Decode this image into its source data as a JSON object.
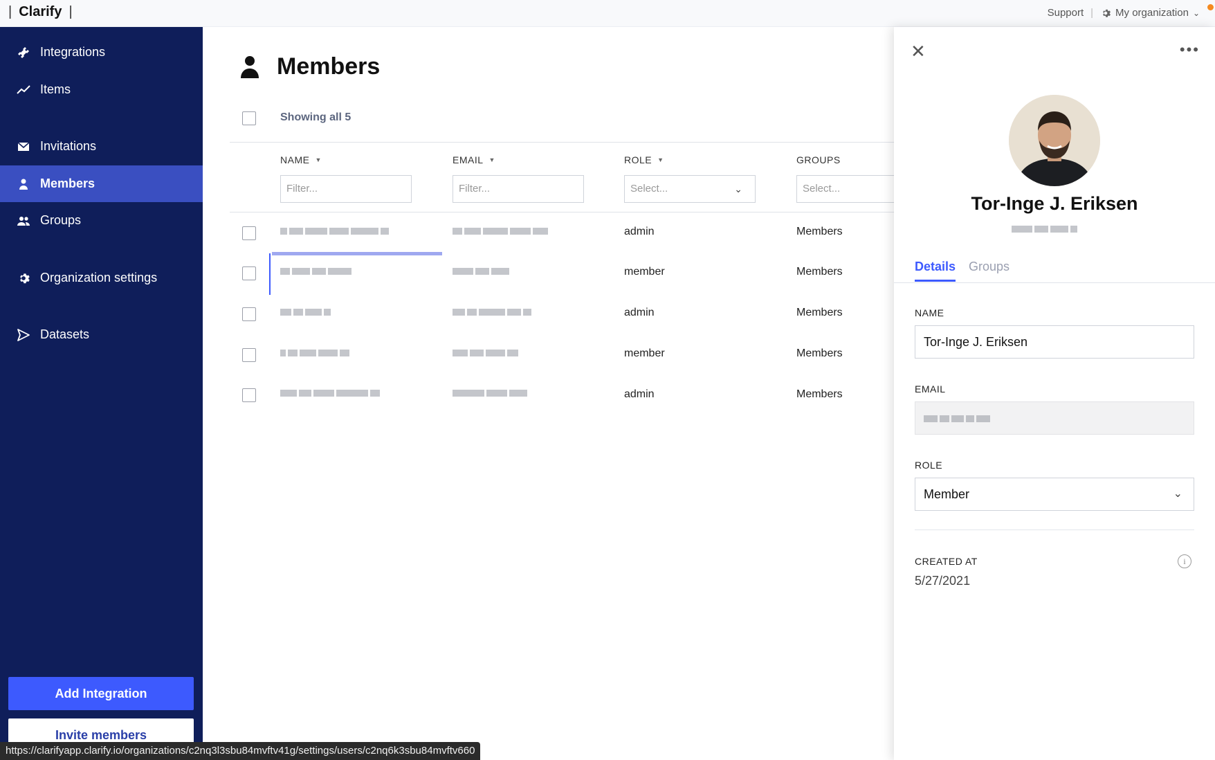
{
  "app": {
    "brand": "Clarify"
  },
  "topbar": {
    "support": "Support",
    "org_menu": "My organization"
  },
  "sidebar": {
    "items": [
      {
        "label": "Integrations",
        "icon": "plug-icon"
      },
      {
        "label": "Items",
        "icon": "trend-icon"
      },
      {
        "label": "Invitations",
        "icon": "envelope-icon"
      },
      {
        "label": "Members",
        "icon": "person-icon",
        "active": true
      },
      {
        "label": "Groups",
        "icon": "people-icon"
      },
      {
        "label": "Organization settings",
        "icon": "gear-icon"
      },
      {
        "label": "Datasets",
        "icon": "send-icon"
      }
    ],
    "add_integration": "Add Integration",
    "invite_members": "Invite members"
  },
  "main": {
    "title": "Members",
    "showing": "Showing all 5",
    "columns": [
      {
        "label": "NAME",
        "placeholder": "Filter..."
      },
      {
        "label": "EMAIL",
        "placeholder": "Filter..."
      },
      {
        "label": "ROLE",
        "placeholder": "Select..."
      },
      {
        "label": "GROUPS",
        "placeholder": "Select..."
      }
    ],
    "rows": [
      {
        "role": "admin",
        "groups": "Members"
      },
      {
        "role": "member",
        "groups": "Members"
      },
      {
        "role": "admin",
        "groups": "Members"
      },
      {
        "role": "member",
        "groups": "Members"
      },
      {
        "role": "admin",
        "groups": "Members"
      }
    ]
  },
  "panel": {
    "name": "Tor-Inge J. Eriksen",
    "tabs": [
      "Details",
      "Groups"
    ],
    "name_label": "NAME",
    "name_value": "Tor-Inge J. Eriksen",
    "email_label": "EMAIL",
    "role_label": "ROLE",
    "role_value": "Member",
    "created_label": "CREATED AT",
    "created_value": "5/27/2021"
  },
  "status_url": "https://clarifyapp.clarify.io/organizations/c2nq3l3sbu84mvftv41g/settings/users/c2nq6k3sbu84mvftv660",
  "colors": {
    "sidebar": "#0f1e5a",
    "active": "#3a4fc1",
    "accent": "#3d5afe"
  }
}
